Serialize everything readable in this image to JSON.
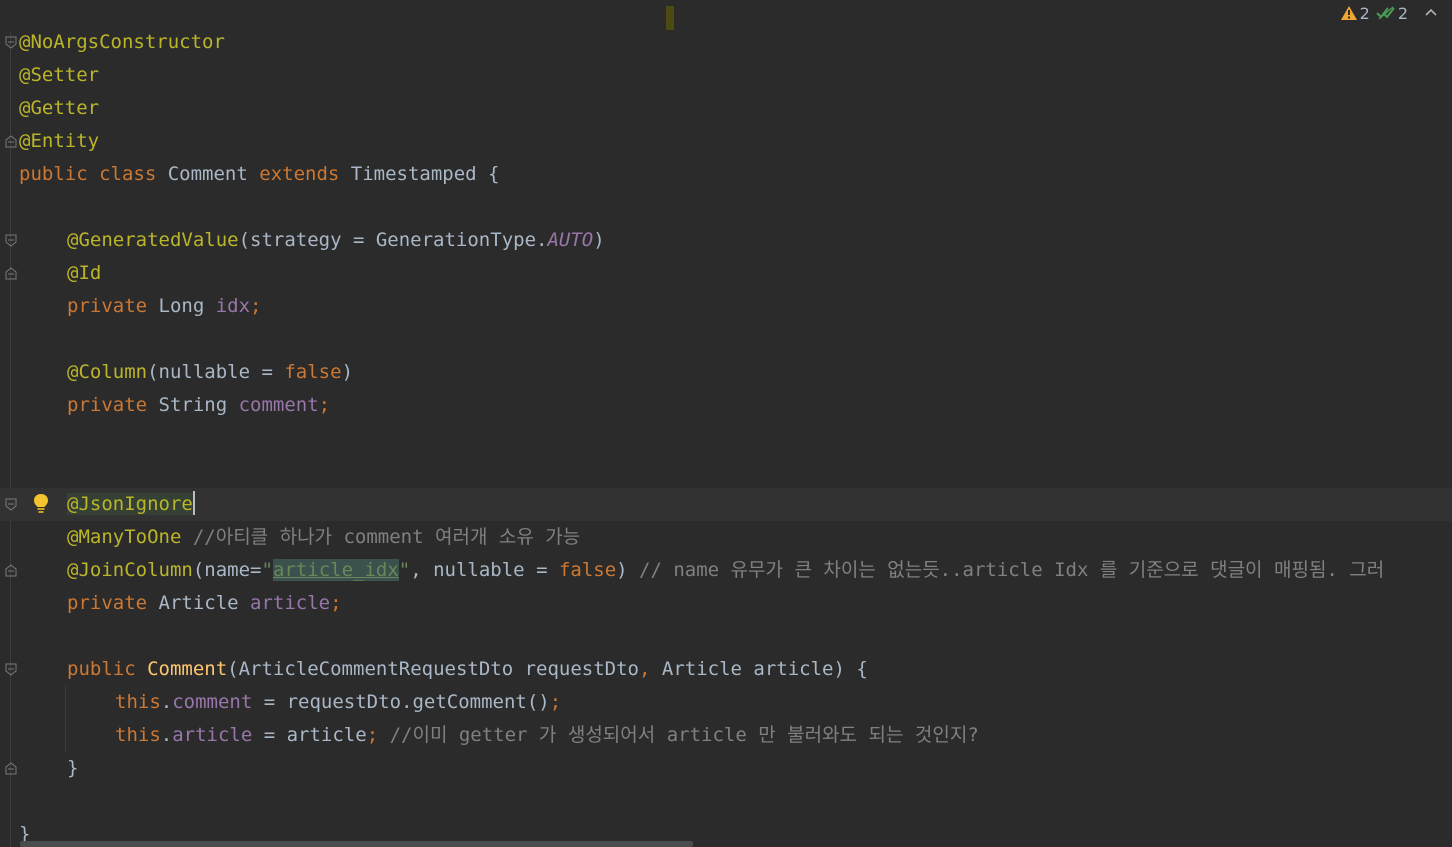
{
  "editor": {
    "status": {
      "warnings_count": "2",
      "weak_warnings_count": "2",
      "warning_icon": "warning-triangle-icon",
      "ok_icon": "check-double-icon",
      "collapse_icon": "chevron-up-icon"
    },
    "lines": [
      {
        "text": "@NoArgsConstructor"
      },
      {
        "text": "@Setter"
      },
      {
        "text": "@Getter"
      },
      {
        "text": "@Entity"
      },
      {
        "t1": "public",
        "t2": " ",
        "t3": "class",
        "t4": " Comment ",
        "t5": "extends",
        "t6": " Timestamped {"
      },
      {
        "text": ""
      },
      {
        "ann": "@GeneratedValue",
        "t2": "(strategy = GenerationType.",
        "t3": "AUTO",
        "t4": ")"
      },
      {
        "text": "@Id"
      },
      {
        "kw": "private",
        "t2": " Long ",
        "fld": "idx",
        "t4": ";"
      },
      {
        "text": ""
      },
      {
        "ann": "@Column",
        "t2": "(nullable = ",
        "kw": "false",
        "t4": ")"
      },
      {
        "kw": "private",
        "t2": " String ",
        "fld": "comment",
        "t4": ";"
      },
      {
        "text": ""
      },
      {
        "text": ""
      },
      {
        "ann": "@JsonIgnore"
      },
      {
        "ann": "@ManyToOne",
        "cmt": " //아티클 하나가 comment 여러개 소유 가능"
      },
      {
        "ann": "@JoinColumn",
        "t2": "(name=",
        "q1": "\"",
        "str": "article_idx",
        "q2": "\"",
        "t3": ", nullable = ",
        "kw": "false",
        "t4": ")",
        "cmt": " // name 유무가 큰 차이는 없는듯..article Idx 를 기준으로 댓글이 매핑됨. 그러"
      },
      {
        "kw": "private",
        "t2": " Article ",
        "fld": "article",
        "t4": ";"
      },
      {
        "text": ""
      },
      {
        "kw": "public",
        "t2": " ",
        "fn": "Comment",
        "t3": "(ArticleCommentRequestDto requestDto",
        "comma": ",",
        "t4": " Article article) {"
      },
      {
        "kw": "this",
        "dot": ".",
        "fld": "comment",
        "t2": " = requestDto.getComment()",
        "semi": ";"
      },
      {
        "kw": "this",
        "dot": ".",
        "fld": "article",
        "t2": " = article",
        "semi": ";",
        "cmt": " //이미 getter 가 생성되어서 article 만 불러와도 되는 것인지?"
      },
      {
        "text": "}"
      },
      {
        "text": ""
      },
      {
        "text": "}"
      }
    ]
  }
}
